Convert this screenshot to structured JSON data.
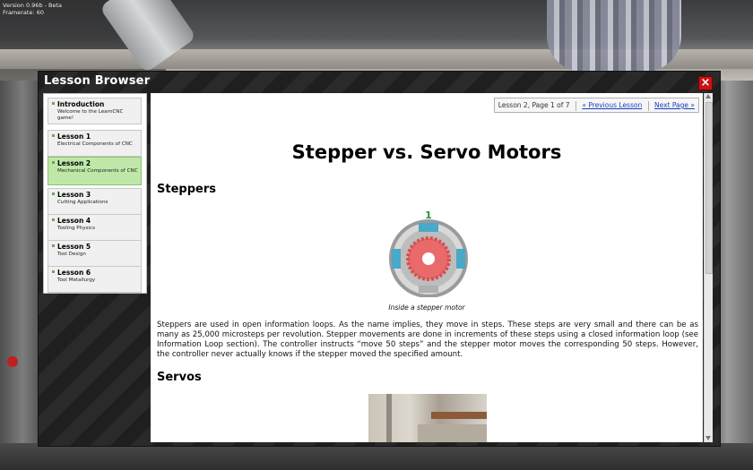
{
  "app": {
    "version": "Version 0.96b - Beta",
    "framerate": "Framerate: 60"
  },
  "dialog": {
    "title": "Lesson Browser",
    "close_label": "×"
  },
  "lessons": [
    {
      "name": "Introduction",
      "desc": "Welcome to the LearnCNC game!",
      "active": false
    },
    {
      "name": "Lesson 1",
      "desc": "Electrical Components of CNC",
      "active": false
    },
    {
      "name": "Lesson 2",
      "desc": "Mechanical Components of CNC",
      "active": true
    },
    {
      "name": "Lesson 3",
      "desc": "Cutting Applications",
      "active": false
    },
    {
      "name": "Lesson 4",
      "desc": "Tooling Physics",
      "active": false
    },
    {
      "name": "Lesson 5",
      "desc": "Tool Design",
      "active": false
    },
    {
      "name": "Lesson 6",
      "desc": "Tool Metallurgy",
      "active": false
    }
  ],
  "pager": {
    "info": "Lesson 2, Page 1 of 7",
    "prev": "« Previous Lesson",
    "next": "Next Page »"
  },
  "content": {
    "title": "Stepper vs. Servo Motors",
    "section1": "Steppers",
    "motor_number": "1",
    "caption": "Inside a stepper motor",
    "paragraph": "Steppers are used in open information loops. As the name implies, they move in steps. These steps are very small and there can be as many as 25,000 microsteps per revolution. Stepper movements are done in increments of these steps using a closed information loop (see Information Loop section). The controller instructs “move 50 steps” and the stepper motor moves the corresponding 50 steps. However, the controller never actually knows if the stepper moved the specified amount.",
    "section2": "Servos"
  },
  "colors": {
    "active_lesson": "#bfe8a8",
    "link": "#1a3cc2",
    "close": "#c41414",
    "rotor": "#e86a6a",
    "coil": "#4aa8c8"
  }
}
